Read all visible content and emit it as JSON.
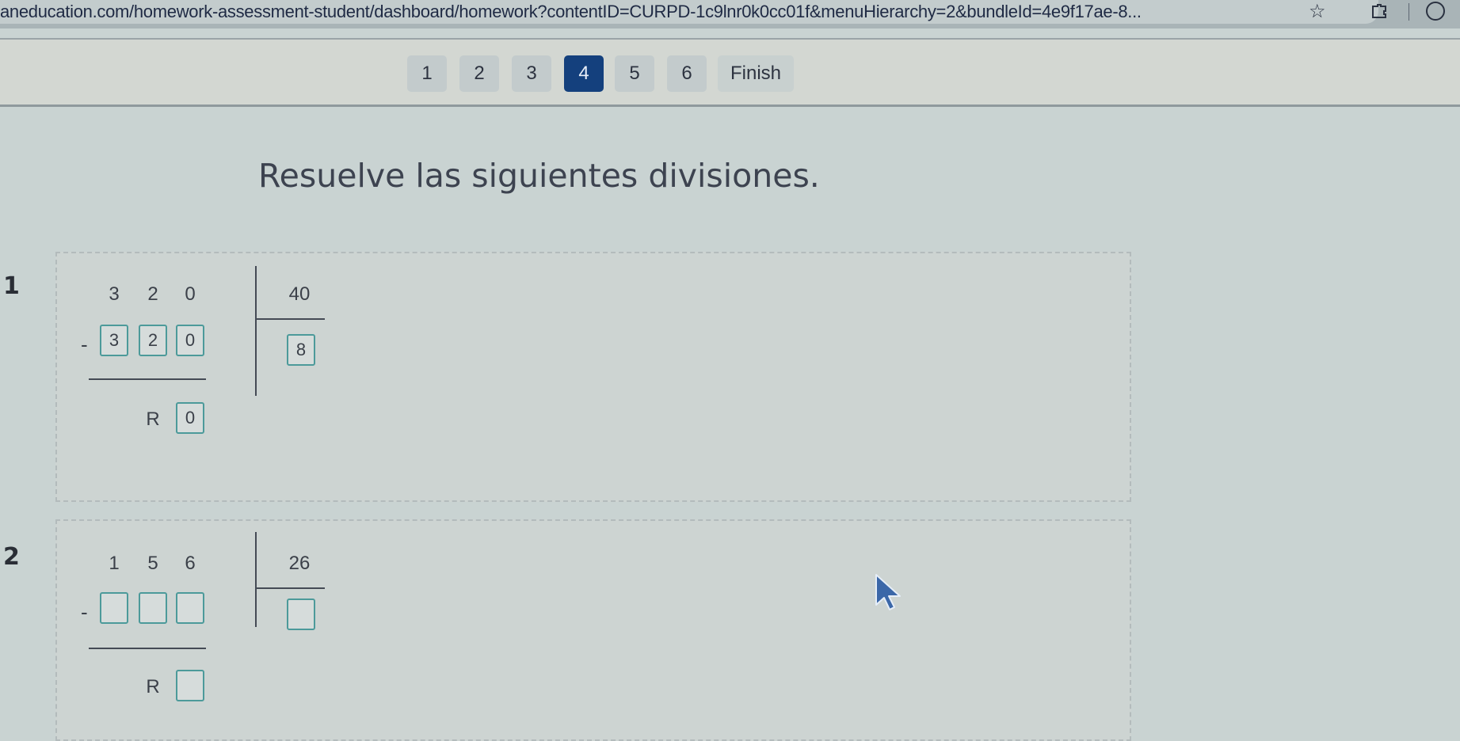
{
  "browser": {
    "url": "aneducation.com/homework-assessment-student/dashboard/homework?contentID=CURPD-1c9lnr0k0cc01f&menuHierarchy=2&bundleId=4e9f17ae-8..."
  },
  "nav": {
    "items": [
      {
        "label": "1"
      },
      {
        "label": "2"
      },
      {
        "label": "3"
      },
      {
        "label": "4"
      },
      {
        "label": "5"
      },
      {
        "label": "6"
      },
      {
        "label": "Finish"
      }
    ],
    "active_index": 3,
    "active_color": "#14407d"
  },
  "title": "Resuelve las siguientes divisiones.",
  "questions": [
    {
      "number": "1",
      "dividend": [
        "3",
        "2",
        "0"
      ],
      "divisor": "40",
      "quotient": "8",
      "subtrahend": [
        "3",
        "2",
        "0"
      ],
      "minus": "-",
      "remainder_label": "R",
      "remainder": "0"
    },
    {
      "number": "2",
      "dividend": [
        "1",
        "5",
        "6"
      ],
      "divisor": "26",
      "quotient": "",
      "subtrahend": [
        "",
        "",
        ""
      ],
      "minus": "-",
      "remainder_label": "R",
      "remainder": ""
    }
  ],
  "icons": [
    "star-icon",
    "extension-icon",
    "profile-icon",
    "mouse-cursor-icon"
  ]
}
